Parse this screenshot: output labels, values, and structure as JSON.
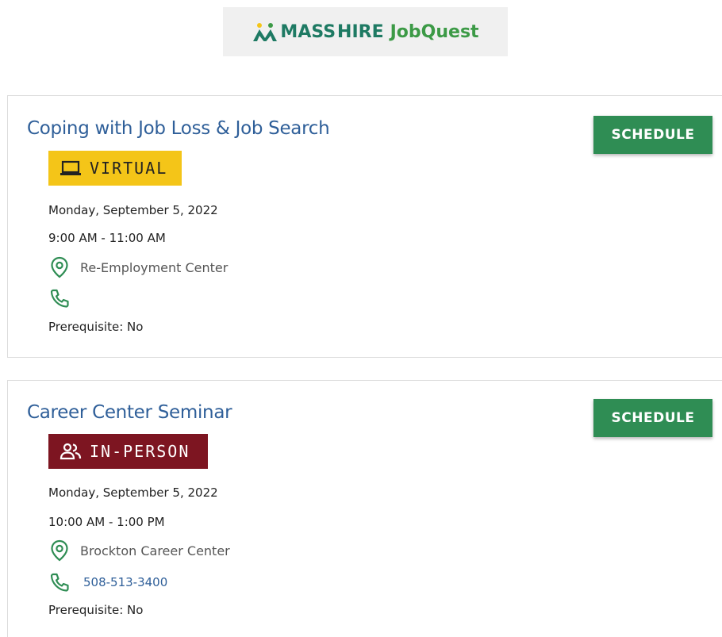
{
  "header": {
    "logo_mass": "MASS",
    "logo_hire": "HIRE",
    "logo_jobquest": "JobQuest"
  },
  "colors": {
    "accent_green": "#2f8d54",
    "title_blue": "#2f5f99",
    "virtual_badge": "#f4c518",
    "inperson_badge": "#7d1521"
  },
  "events": [
    {
      "title": "Coping with Job Loss & Job Search",
      "schedule_label": "SCHEDULE",
      "badge_label": "VIRTUAL",
      "badge_icon": "laptop-icon",
      "date": "Monday, September 5, 2022",
      "time": "9:00 AM - 11:00 AM",
      "location": "Re-Employment Center",
      "phone": "",
      "prerequisite": "Prerequisite: No"
    },
    {
      "title": "Career Center Seminar",
      "schedule_label": "SCHEDULE",
      "badge_label": "IN-PERSON",
      "badge_icon": "people-icon",
      "date": "Monday, September 5, 2022",
      "time": "10:00 AM - 1:00 PM",
      "location": "Brockton Career Center",
      "phone": "508-513-3400",
      "prerequisite": "Prerequisite: No"
    }
  ]
}
